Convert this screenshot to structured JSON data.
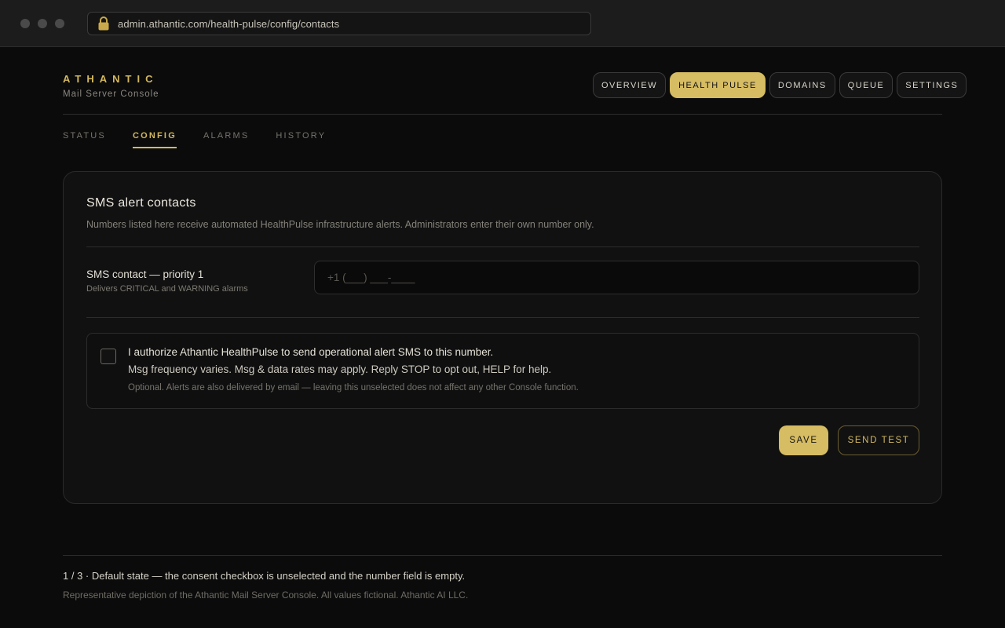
{
  "browser": {
    "url": "admin.athantic.com/health-pulse/config/contacts",
    "icons": [
      "lock-icon"
    ]
  },
  "header": {
    "brand": "ATHANTIC",
    "subtitle": "Mail Server Console",
    "nav": [
      {
        "label": "OVERVIEW",
        "active": false
      },
      {
        "label": "HEALTH PULSE",
        "active": true
      },
      {
        "label": "DOMAINS",
        "active": false
      },
      {
        "label": "QUEUE",
        "active": false
      },
      {
        "label": "SETTINGS",
        "active": false
      }
    ]
  },
  "subtabs": [
    {
      "label": "STATUS",
      "active": false
    },
    {
      "label": "CONFIG",
      "active": true
    },
    {
      "label": "ALARMS",
      "active": false
    },
    {
      "label": "HISTORY",
      "active": false
    }
  ],
  "card": {
    "title": "SMS alert contacts",
    "description": "Numbers listed here receive automated HealthPulse infrastructure alerts. Administrators enter their own number only.",
    "field": {
      "label": "SMS contact — priority 1",
      "help": "Delivers CRITICAL and WARNING alarms",
      "value": "",
      "placeholder": "+1 (___) ___-____"
    },
    "consent": {
      "checked": false,
      "title": "I authorize Athantic HealthPulse to send operational alert SMS to this number.",
      "terms": "Msg frequency varies. Msg & data rates may apply. Reply STOP to opt out, HELP for help.",
      "note": "Optional. Alerts are also delivered by email — leaving this unselected does not affect any other Console function."
    },
    "actions": {
      "save": "SAVE",
      "send_test": "SEND TEST"
    }
  },
  "footer": {
    "state": "1 / 3 · Default state — the consent checkbox is unselected and the number field is empty.",
    "note": "Representative depiction of the Athantic Mail Server Console. All values fictional. Athantic AI LLC."
  },
  "colors": {
    "accent": "#d6bc62",
    "background": "#0b0b0b",
    "card": "#111111"
  }
}
